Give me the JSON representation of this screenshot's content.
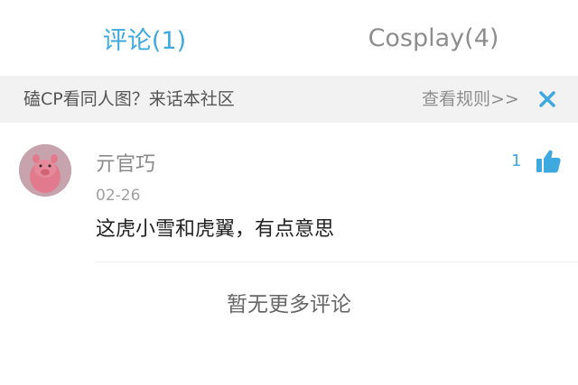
{
  "tabs": [
    {
      "label": "评论(1)",
      "active": true
    },
    {
      "label": "Cosplay(4)",
      "active": false
    }
  ],
  "banner": {
    "text": "磕CP看同人图？来话本社区",
    "rules_link": "查看规则>>",
    "close_icon": "close-icon"
  },
  "comment": {
    "username": "亓官巧",
    "date": "02-26",
    "text": "这虎小雪和虎翼，有点意思",
    "like_count": "1",
    "like_icon": "thumbs-up-icon"
  },
  "footer": {
    "no_more_text": "暂无更多评论"
  },
  "colors": {
    "accent": "#3ea9df",
    "banner_bg": "#f2f2f2",
    "text_muted": "#8a8a8a",
    "text_main": "#222222"
  }
}
